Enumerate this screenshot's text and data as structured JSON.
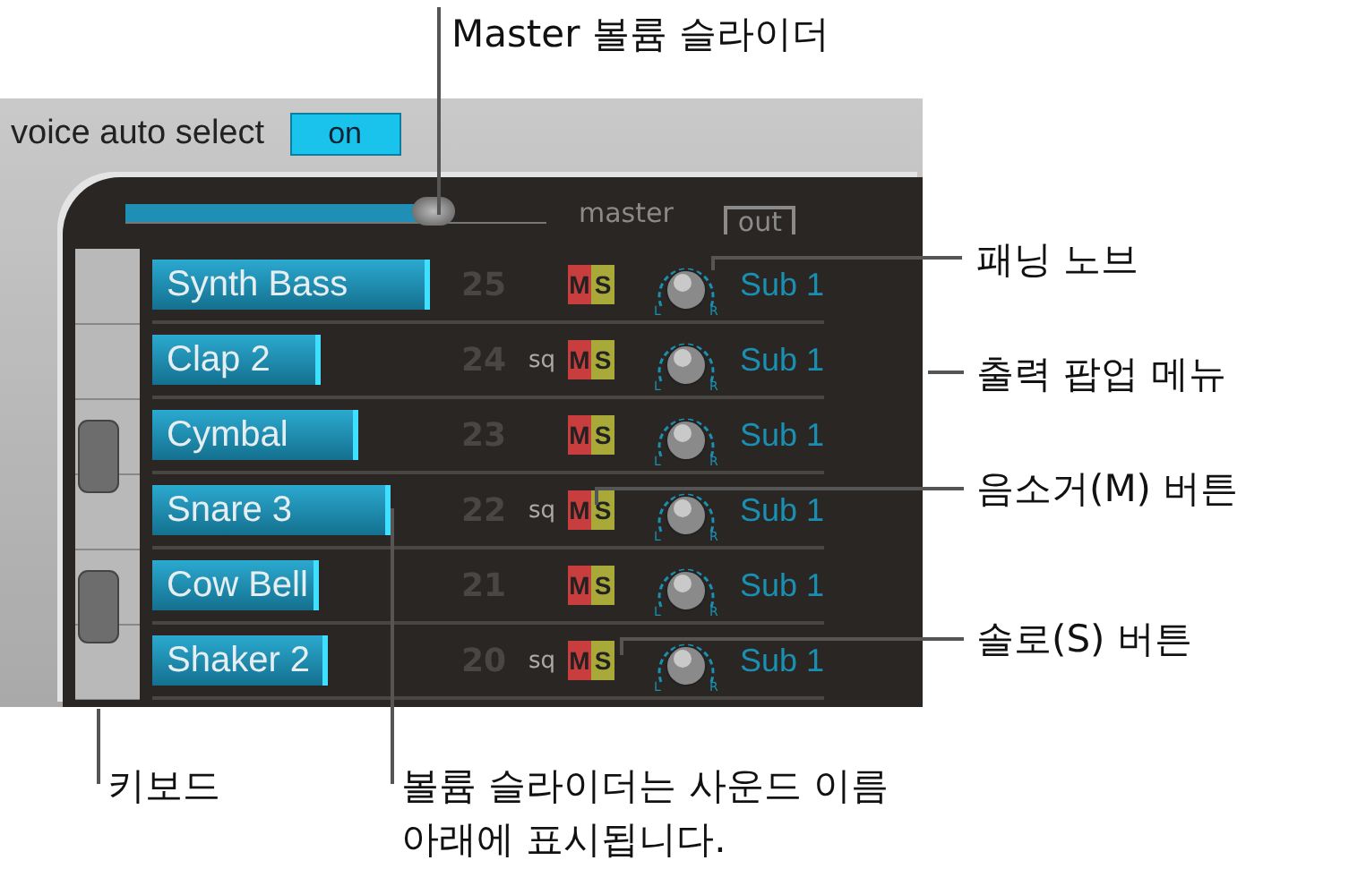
{
  "panel": {
    "voice_auto_select_label": "voice auto select",
    "voice_auto_select_button": "on",
    "master": {
      "label": "master",
      "level": 0.73
    },
    "out_label": "out",
    "rows": [
      {
        "name": "Synth Bass",
        "level": 0.97,
        "number": "25",
        "mode": "",
        "mute": "M",
        "solo": "S",
        "pan_left": "L",
        "pan_right": "R",
        "output": "Sub 1"
      },
      {
        "name": "Clap 2",
        "level": 0.59,
        "number": "24",
        "mode": "sq",
        "mute": "M",
        "solo": "S",
        "pan_left": "L",
        "pan_right": "R",
        "output": "Sub 1"
      },
      {
        "name": "Cymbal",
        "level": 0.72,
        "number": "23",
        "mode": "",
        "mute": "M",
        "solo": "S",
        "pan_left": "L",
        "pan_right": "R",
        "output": "Sub 1"
      },
      {
        "name": "Snare 3",
        "level": 0.83,
        "number": "22",
        "mode": "sq",
        "mute": "M",
        "solo": "S",
        "pan_left": "L",
        "pan_right": "R",
        "output": "Sub 1"
      },
      {
        "name": "Cow Bell",
        "level": 0.58,
        "number": "21",
        "mode": "",
        "mute": "M",
        "solo": "S",
        "pan_left": "L",
        "pan_right": "R",
        "output": "Sub 1"
      },
      {
        "name": "Shaker 2",
        "level": 0.61,
        "number": "20",
        "mode": "sq",
        "mute": "M",
        "solo": "S",
        "pan_left": "L",
        "pan_right": "R",
        "output": "Sub 1"
      }
    ]
  },
  "callouts": {
    "master_slider": "Master 볼륨 슬라이더",
    "pan_knob": "패닝 노브",
    "output_menu": "출력 팝업 메뉴",
    "mute_button": "음소거(M) 버튼",
    "solo_button": "솔로(S) 버튼",
    "keyboard": "키보드",
    "volume_slider": "볼륨 슬라이더는 사운드 이름 아래에 표시됩니다."
  }
}
